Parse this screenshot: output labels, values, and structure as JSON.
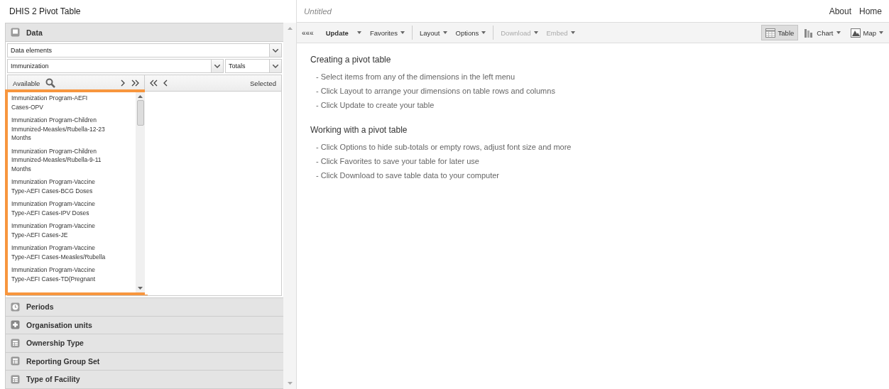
{
  "app_title": "DHIS 2 Pivot Table",
  "header": {
    "document_title": "Untitled",
    "links": [
      "About",
      "Home"
    ]
  },
  "data_section": {
    "title": "Data",
    "data_type": "Data elements",
    "group_search": "Immunization",
    "details": "Totals",
    "available_label": "Available",
    "selected_label": "Selected",
    "available_items": [
      "Immunization Program-AEFI Cases-OPV",
      "Immunization Program-Children Immunized-Measles/Rubella-12-23 Months",
      "Immunization Program-Children Immunized-Measles/Rubella-9-11 Months",
      "Immunization Program-Vaccine Type-AEFI Cases-BCG Doses",
      "Immunization Program-Vaccine Type-AEFI Cases-IPV Doses",
      "Immunization Program-Vaccine Type-AEFI Cases-JE",
      "Immunization Program-Vaccine Type-AEFI Cases-Measles/Rubella",
      "Immunization Program-Vaccine Type-AEFI Cases-TD(Pregnant"
    ]
  },
  "sections": [
    {
      "title": "Periods",
      "kind": "clock"
    },
    {
      "title": "Organisation units",
      "kind": "plus"
    },
    {
      "title": "Ownership Type",
      "kind": "grid"
    },
    {
      "title": "Reporting Group Set",
      "kind": "grid"
    },
    {
      "title": "Type of Facility",
      "kind": "grid"
    }
  ],
  "toolbar": [
    {
      "label": "«««",
      "kind": "collapse",
      "disabled": false
    },
    {
      "label": "Update",
      "kind": "split",
      "disabled": false,
      "menu": true
    },
    {
      "label": "Favorites",
      "kind": "menu",
      "disabled": false,
      "menu": true
    },
    {
      "label": "Layout",
      "kind": "menu",
      "disabled": false,
      "menu": true,
      "separator": true
    },
    {
      "label": "Options",
      "kind": "menu",
      "disabled": false,
      "menu": true
    },
    {
      "label": "Download",
      "kind": "menu",
      "disabled": true,
      "menu": true,
      "separator": true
    },
    {
      "label": "Embed",
      "kind": "menu",
      "disabled": true,
      "menu": true
    }
  ],
  "views": [
    {
      "label": "Table",
      "kind": "table",
      "selected": true,
      "menu": false
    },
    {
      "label": "Chart",
      "kind": "chart",
      "selected": false,
      "menu": true
    },
    {
      "label": "Map",
      "kind": "map",
      "selected": false,
      "menu": true
    }
  ],
  "help": [
    {
      "heading": "Creating a pivot table",
      "lines": [
        "- Select items from any of the dimensions in the left menu",
        "- Click Layout to arrange your dimensions on table rows and columns",
        "- Click Update to create your table"
      ]
    },
    {
      "heading": "Working with a pivot table",
      "lines": [
        "- Click Options to hide sub-totals or empty rows, adjust font size and more",
        "- Click Favorites to save your table for later use",
        "- Click Download to save table data to your computer"
      ]
    }
  ]
}
